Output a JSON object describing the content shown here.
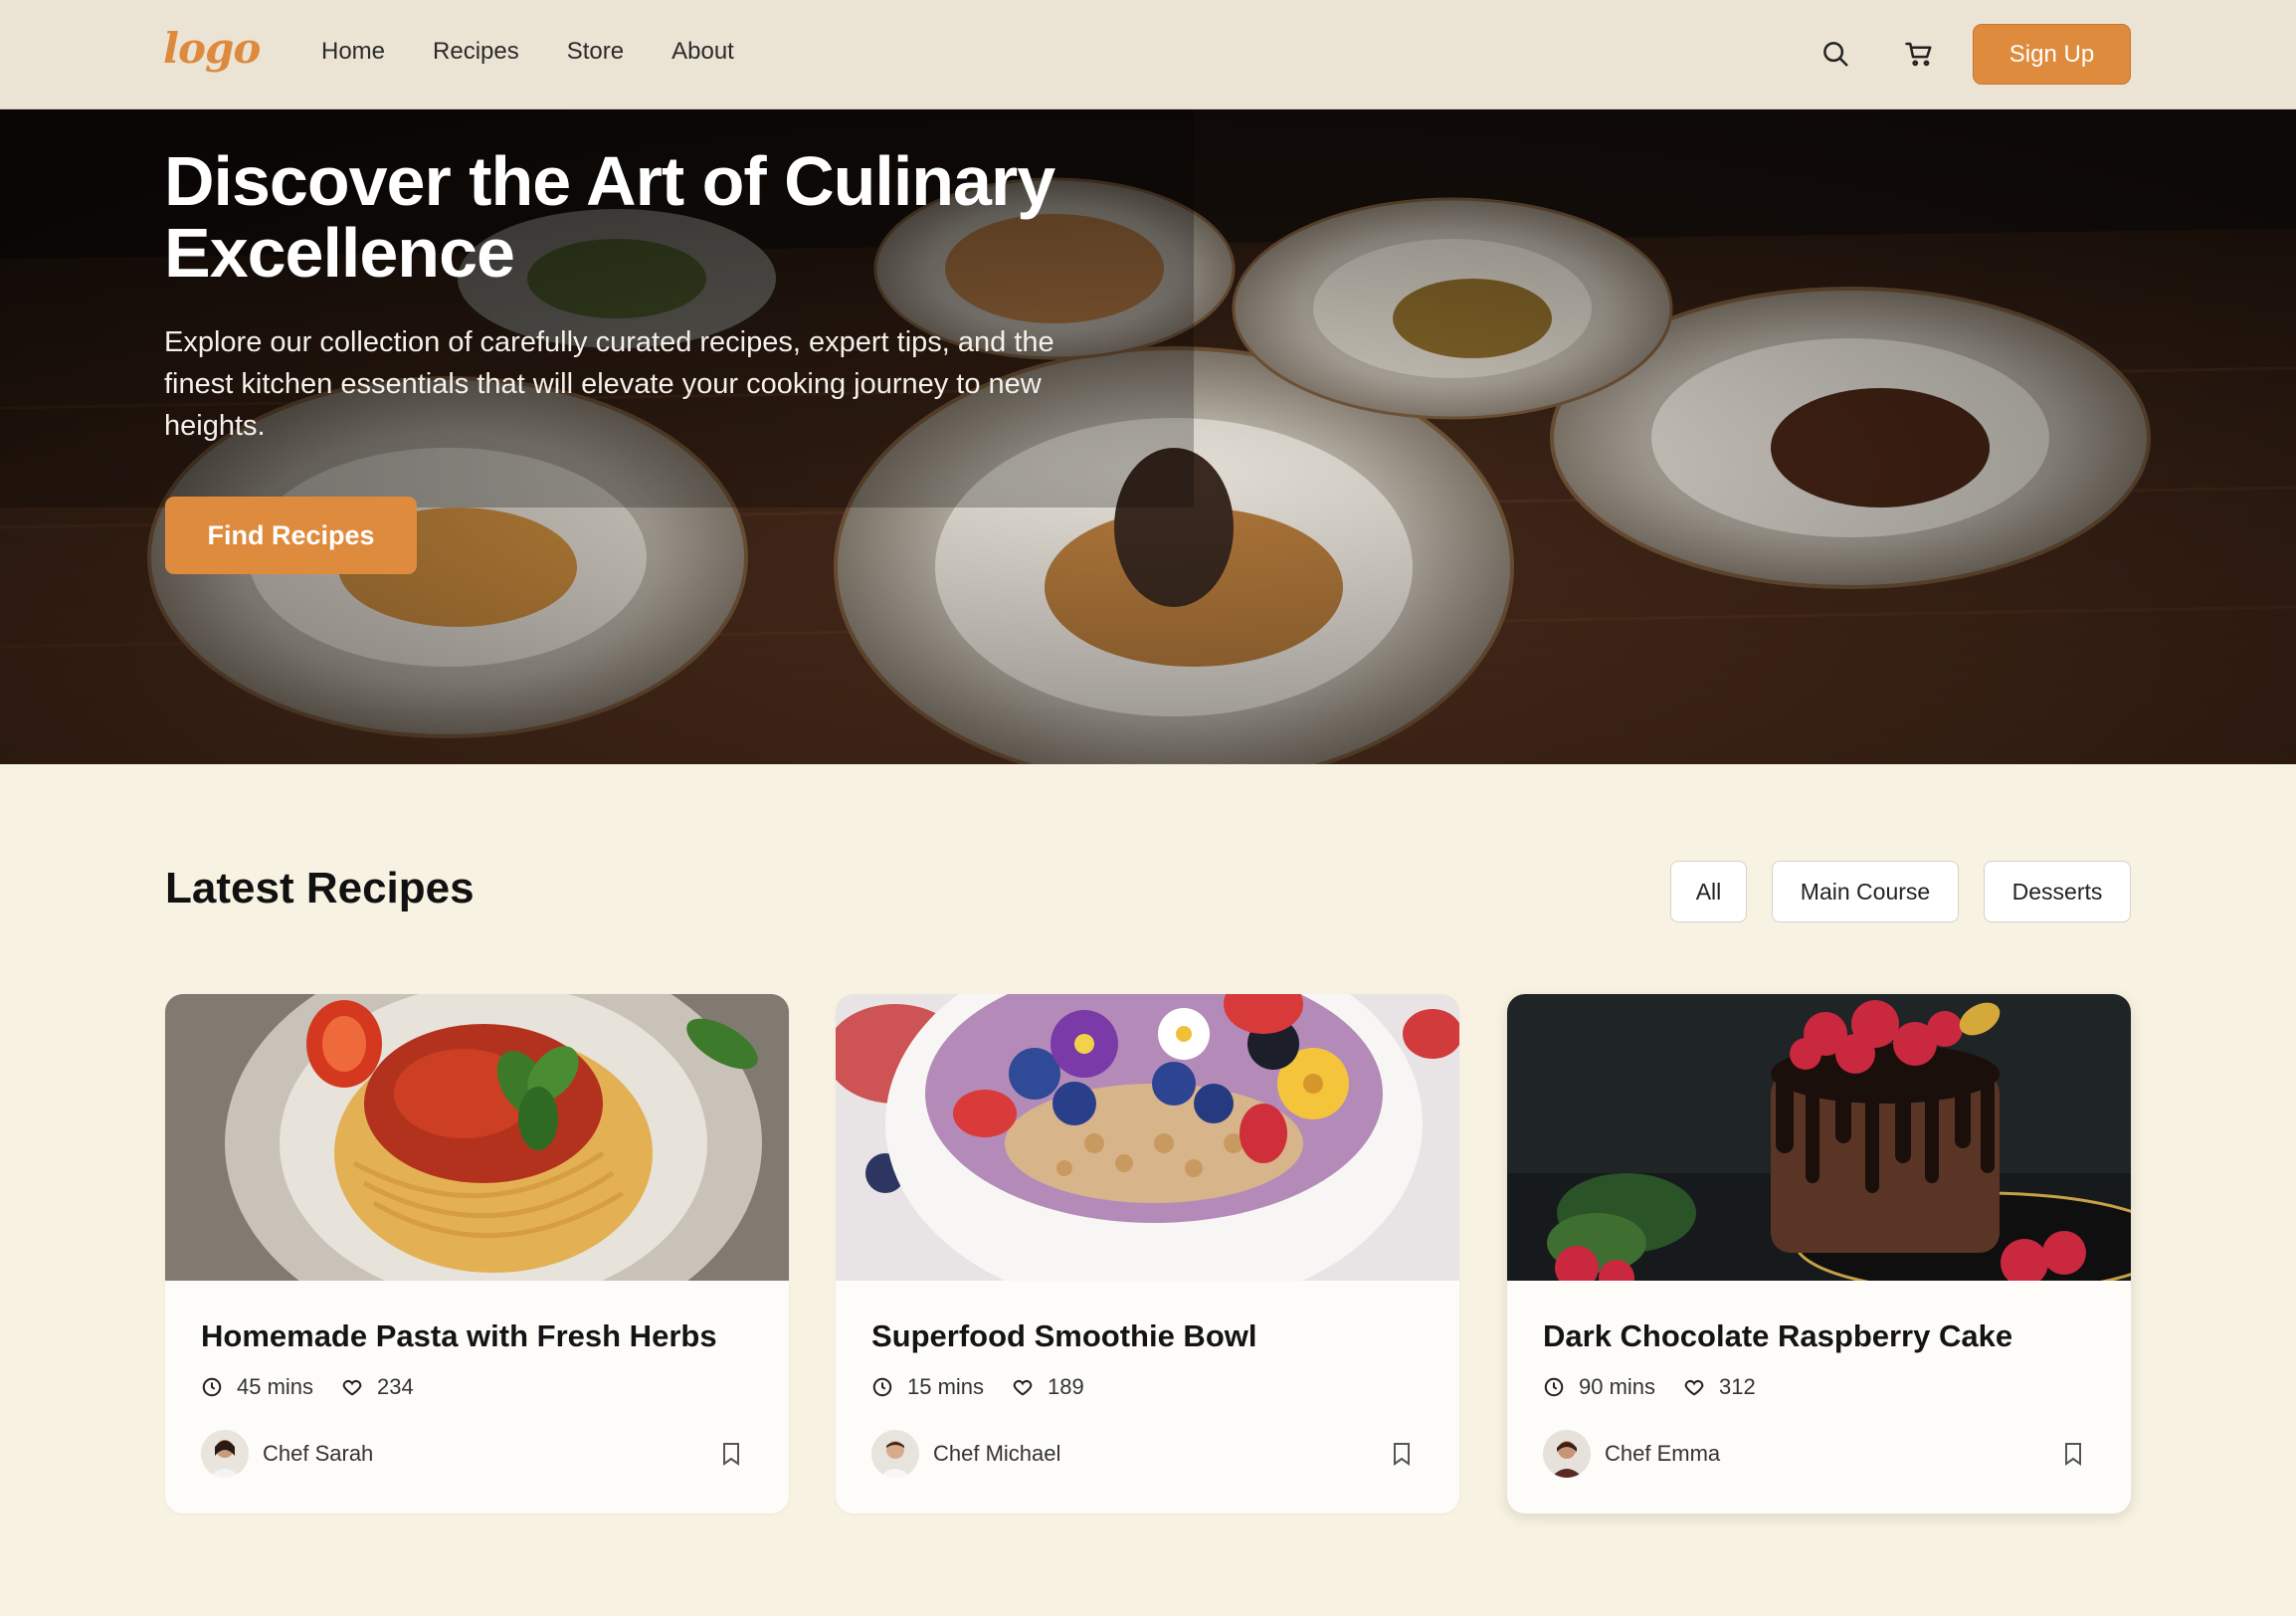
{
  "header": {
    "logo_text": "logo",
    "nav": [
      "Home",
      "Recipes",
      "Store",
      "About"
    ],
    "signup_label": "Sign Up",
    "icons": [
      "search-icon",
      "cart-icon"
    ]
  },
  "hero": {
    "title": "Discover the Art of Culinary Excellence",
    "description": "Explore our collection of carefully curated recipes, expert tips, and the finest kitchen essentials that will elevate your cooking journey to new heights.",
    "cta_label": "Find Recipes"
  },
  "latest": {
    "title": "Latest Recipes",
    "filters": [
      "All",
      "Main Course",
      "Desserts"
    ]
  },
  "recipes": [
    {
      "title": "Homemade Pasta with Fresh Herbs",
      "time": "45 mins",
      "likes": "234",
      "chef": "Chef Sarah"
    },
    {
      "title": "Superfood Smoothie Bowl",
      "time": "15 mins",
      "likes": "189",
      "chef": "Chef Michael"
    },
    {
      "title": "Dark Chocolate Raspberry Cake",
      "time": "90 mins",
      "likes": "312",
      "chef": "Chef Emma"
    }
  ],
  "colors": {
    "accent": "#df8b3d",
    "page_bg": "#f8f2e2",
    "nav_bg": "#ebe3d3",
    "card_bg": "#fdfcf9"
  }
}
